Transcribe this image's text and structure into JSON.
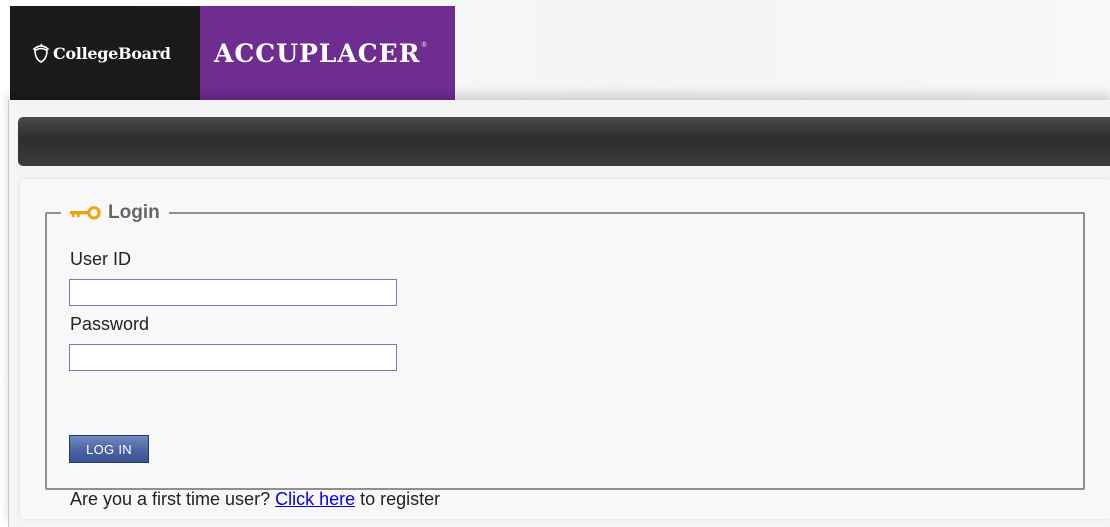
{
  "header": {
    "collegeboard_logo_text": "CollegeBoard",
    "accuplacer_logo_text": "ACCUPLACER",
    "accuplacer_reg_mark": "®"
  },
  "login": {
    "legend_title": "Login",
    "user_id_label": "User ID",
    "user_id_value": "",
    "password_label": "Password",
    "password_value": "",
    "login_button_label": "LOG IN",
    "register_prefix": "Are you a first time user?",
    "register_link_label": "Click here",
    "register_suffix": "to register"
  },
  "colors": {
    "collegeboard_bg": "#1b1b1b",
    "accuplacer_bg": "#6f2c91",
    "key_icon": "#f0a30a",
    "button_blue": "#4b63a2",
    "link": "#0000ee"
  },
  "icons": {
    "legend_icon": "key-icon",
    "logo_icon": "acorn-icon"
  }
}
